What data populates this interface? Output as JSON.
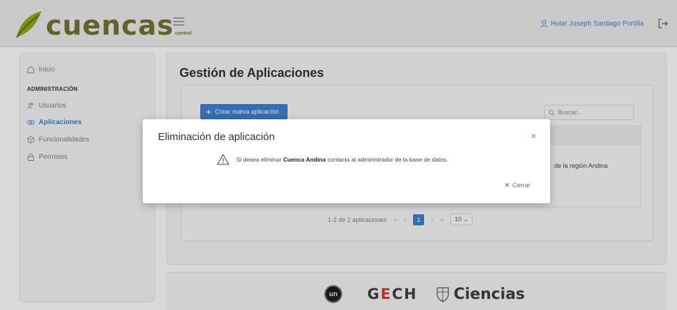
{
  "header": {
    "logo_text": "cuencas",
    "logo_sub": "control",
    "greeting": "Hola! Joseph Santiago Portilla"
  },
  "sidebar": {
    "section_title": "ADMINISTRACIÓN",
    "items": [
      {
        "label": "Inicio",
        "icon": "home-icon"
      },
      {
        "label": "Usuarios",
        "icon": "users-icon"
      },
      {
        "label": "Aplicaciones",
        "icon": "link-icon",
        "active": true
      },
      {
        "label": "Funcionalidades",
        "icon": "cube-icon"
      },
      {
        "label": "Permisos",
        "icon": "lock-icon"
      }
    ]
  },
  "main": {
    "title": "Gestión de Aplicaciones",
    "create_label": "Crear nueva aplicación",
    "search_placeholder": "Buscar...",
    "row_text": "de la región Andina",
    "pagination": {
      "summary": "1-2 de 2 aplicaciones",
      "first": "«",
      "prev": "‹",
      "current": "1",
      "next": "›",
      "last": "»",
      "per_page": "10"
    }
  },
  "footer": {
    "un": "un",
    "gech_g": "G",
    "gech_e": "E",
    "gech_rest": "CH",
    "ciencias": "Ciencias"
  },
  "modal": {
    "title": "Eliminación de aplicación",
    "close": "×",
    "msg_prefix": "Si desea eliminar",
    "msg_name": "Cuenca Andina",
    "msg_suffix": "contacta al administrador de la base de datos.",
    "cerrar": "Cerrar"
  },
  "colors": {
    "accent": "#3a78c0",
    "logo": "#6b6b2e"
  }
}
